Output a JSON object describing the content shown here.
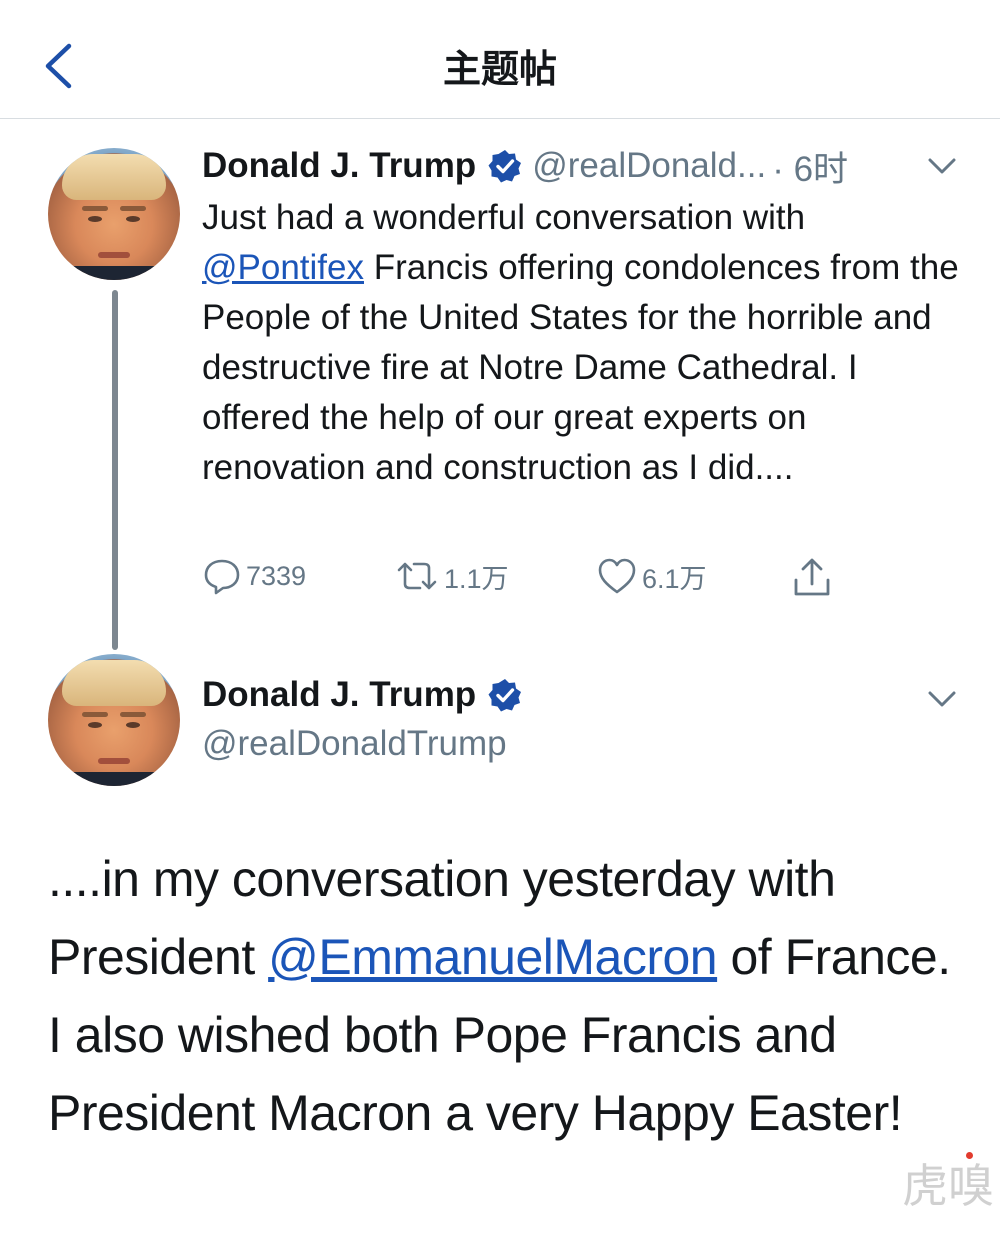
{
  "nav": {
    "title": "主题帖"
  },
  "tweet1": {
    "name": "Donald J. Trump",
    "handle": "@realDonald...",
    "time": "· 6时",
    "body_part1": "Just had a wonderful conversation with ",
    "mention": "@Pontifex",
    "body_part2": " Francis offering condolences from the People of the United States for the horrible and destructive fire at Notre Dame Cathedral. I offered the help of our great experts on renovation and construction as I did....",
    "replies": "7339",
    "retweets": "1.1万",
    "likes": "6.1万"
  },
  "tweet2": {
    "name": "Donald J. Trump",
    "handle": "@realDonaldTrump",
    "body_part1": "....in my conversation yesterday with President ",
    "mention": "@EmmanuelMacron",
    "body_part2": " of France. I also wished both Pope Francis and President Macron a very Happy Easter!"
  },
  "watermark": "虎嗅",
  "colors": {
    "link": "#1b55b8",
    "verified": "#1d4fa8",
    "muted": "#657786"
  }
}
